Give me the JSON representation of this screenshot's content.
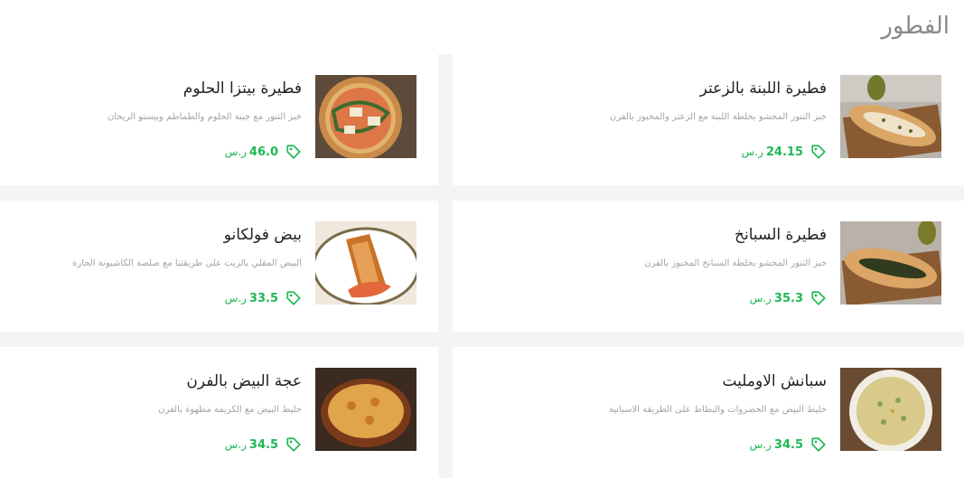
{
  "section": {
    "title": "الفطور"
  },
  "currency": "ر.س",
  "colors": {
    "price": "#1db954",
    "title": "#8a8a8a"
  },
  "items": [
    {
      "name": "فطيرة اللبنة بالزعتر",
      "description": "خبز التنور المحشو بخلطة اللبنة مع الزعتر والمخبوز بالفرن",
      "price": "24.15",
      "image": "labneh-pie-photo"
    },
    {
      "name": "فطيرة بيتزا الحلوم",
      "description": "خبز التنور مع جبنة الحلوم والطماطم وبيستو الريحان",
      "price": "46.0",
      "image": "halloumi-pizza-photo"
    },
    {
      "name": "فطيرة السبانخ",
      "description": "خبز التنور المحشو بخلطة السبانخ المخبوز بالفرن",
      "price": "35.3",
      "image": "spinach-pie-photo"
    },
    {
      "name": "بيض فولكانو",
      "description": "البيض المقلي بالزيت على طريقتنا مع صلصة الكاشيونة الحارة",
      "price": "33.5",
      "image": "volcano-eggs-photo"
    },
    {
      "name": "سبانش الاومليت",
      "description": "خليط البيض مع الخضروات والبطاط على الطريقة الاسبانية",
      "price": "34.5",
      "image": "spanish-omelette-photo"
    },
    {
      "name": "عجة البيض بالفرن",
      "description": "خليط البيض مع الكريمة مطهوة بالفرن",
      "price": "34.5",
      "image": "baked-egg-omelette-photo"
    }
  ]
}
